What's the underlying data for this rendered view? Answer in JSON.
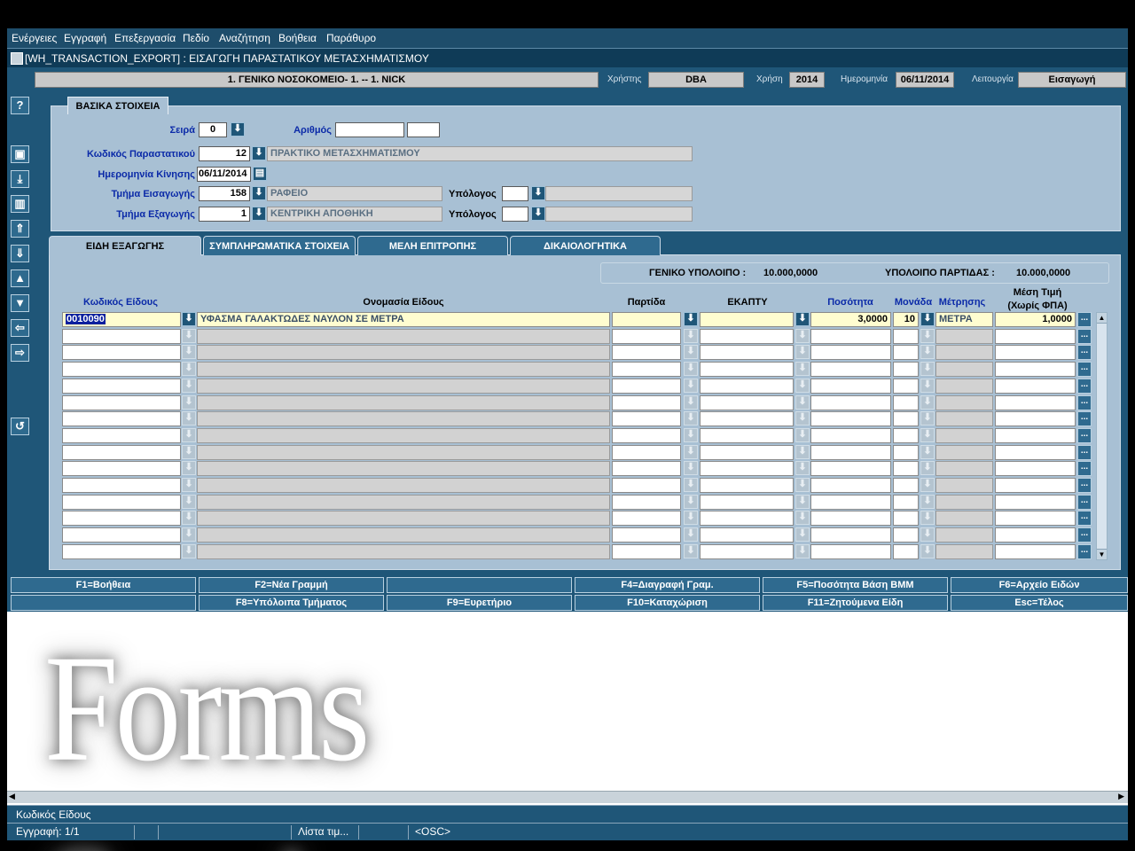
{
  "menu": [
    "Ενέργειες",
    "Εγγραφή",
    "Επεξεργασία",
    "Πεδίο",
    "Αναζήτηση",
    "Βοήθεια",
    "Παράθυρο"
  ],
  "window_title": "[WH_TRANSACTION_EXPORT]  :  ΕΙΣΑΓΩΓΗ ΠΑΡΑΣΤΑΤΙΚΟΥ ΜΕΤΑΣΧΗΜΑΤΙΣΜΟΥ",
  "header": {
    "organization": "1. ΓΕΝΙΚΟ ΝΟΣΟΚΟΜΕΙΟ- 1. -- 1. NICK",
    "user_label": "Χρήστης",
    "user": "DBA",
    "year_label": "Χρήση",
    "year": "2014",
    "date_label": "Ημερομηνία",
    "date": "06/11/2014",
    "function_label": "Λειτουργία",
    "function": "Εισαγωγή"
  },
  "basic": {
    "tab_label": "ΒΑΣΙΚΑ ΣΤΟΙΧΕΙΑ",
    "series_label": "Σειρά",
    "series": "0",
    "number_label": "Αριθμός",
    "number": "",
    "number2": "",
    "doc_code_label": "Κωδικός Παραστατικού",
    "doc_code": "12",
    "doc_desc": "ΠΡΑΚΤΙΚΟ ΜΕΤΑΣΧΗΜΑΤΙΣΜΟΥ",
    "move_date_label": "Ημερομηνία Κίνησης",
    "move_date": "06/11/2014",
    "import_dept_label": "Τμήμα Εισαγωγής",
    "import_dept": "158",
    "import_dept_desc": "ΡΑΦΕΙΟ",
    "export_dept_label": "Τμήμα Εξαγωγής",
    "export_dept": "1",
    "export_dept_desc": "ΚΕΝΤΡΙΚΗ ΑΠΟΘΗΚΗ",
    "responsible_label": "Υπόλογος"
  },
  "tabs": [
    "ΕΙΔΗ ΕΞΑΓΩΓΗΣ",
    "ΣΥΜΠΛΗΡΩΜΑΤΙΚΑ ΣΤΟΙΧΕΙΑ",
    "ΜΕΛΗ ΕΠΙΤΡΟΠΗΣ",
    "ΔΙΚΑΙΟΛΟΓΗΤΙΚΑ"
  ],
  "totals": {
    "general_label": "ΓΕΝΙΚΟ ΥΠΟΛΟΙΠΟ :",
    "general": "10.000,0000",
    "batch_label": "ΥΠΟΛΟΙΠΟ ΠΑΡΤΙΔΑΣ :",
    "batch": "10.000,0000"
  },
  "columns": {
    "code": "Κωδικός Είδους",
    "name": "Ονομασία Είδους",
    "batch": "Παρτίδα",
    "ekapty": "ΕΚΑΠΤΥ",
    "qty": "Ποσότητα",
    "unit_a": "Μονάδα",
    "unit_b": "Μέτρησης",
    "price_a": "Μέση Τιμή",
    "price_b": "(Χωρίς ΦΠΑ)"
  },
  "rows": [
    {
      "code": "0010090",
      "name": "ΥΦΑΣΜΑ ΓΑΛΑΚΤΩΔΕΣ ΝΑΥΛΟΝ ΣΕ ΜΕΤΡΑ",
      "batch": "",
      "ekapty": "",
      "qty": "3,0000",
      "unit_code": "10",
      "unit": "ΜΕΤΡΑ",
      "price": "1,0000"
    }
  ],
  "function_keys_row1": [
    "F1=Βοήθεια",
    "F2=Νέα Γραμμή",
    "",
    "F4=Διαγραφή Γραμ.",
    "F5=Ποσότητα Βάση ΒΜΜ",
    "F6=Αρχείο Ειδών"
  ],
  "function_keys_row2": [
    "",
    "F8=Υπόλοιπα Τμήματος",
    "F9=Ευρετήριο",
    "F10=Καταχώριση",
    "F11=Ζητούμενα Είδη",
    "Esc=Τέλος"
  ],
  "watermark": "Forms Services",
  "status": {
    "hint": "Κωδικός Είδους",
    "record": "Εγγραφή: 1/1",
    "list": "Λίστα τιμ...",
    "mode": "<OSC>"
  }
}
